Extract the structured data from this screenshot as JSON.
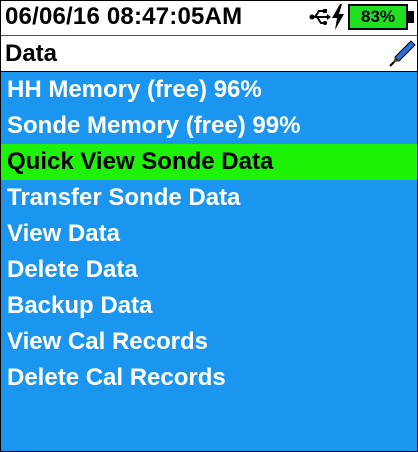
{
  "status": {
    "datetime": "06/06/16  08:47:05AM",
    "battery_percent": "83%",
    "icons": [
      "usb-icon",
      "charging-bolt-icon",
      "battery-icon"
    ],
    "colors": {
      "battery_fill": "#1ee01e"
    }
  },
  "header": {
    "title": "Data",
    "icon": "pen-icon"
  },
  "menu": {
    "colors": {
      "background": "#1a96f0",
      "selected": "#1df207"
    },
    "selected_index": 2,
    "items": [
      {
        "label": "HH Memory (free) 96%"
      },
      {
        "label": "Sonde Memory (free) 99%"
      },
      {
        "label": "Quick View Sonde Data"
      },
      {
        "label": "Transfer Sonde Data"
      },
      {
        "label": "View Data"
      },
      {
        "label": "Delete Data"
      },
      {
        "label": "Backup Data"
      },
      {
        "label": "View Cal Records"
      },
      {
        "label": "Delete Cal Records"
      }
    ]
  }
}
